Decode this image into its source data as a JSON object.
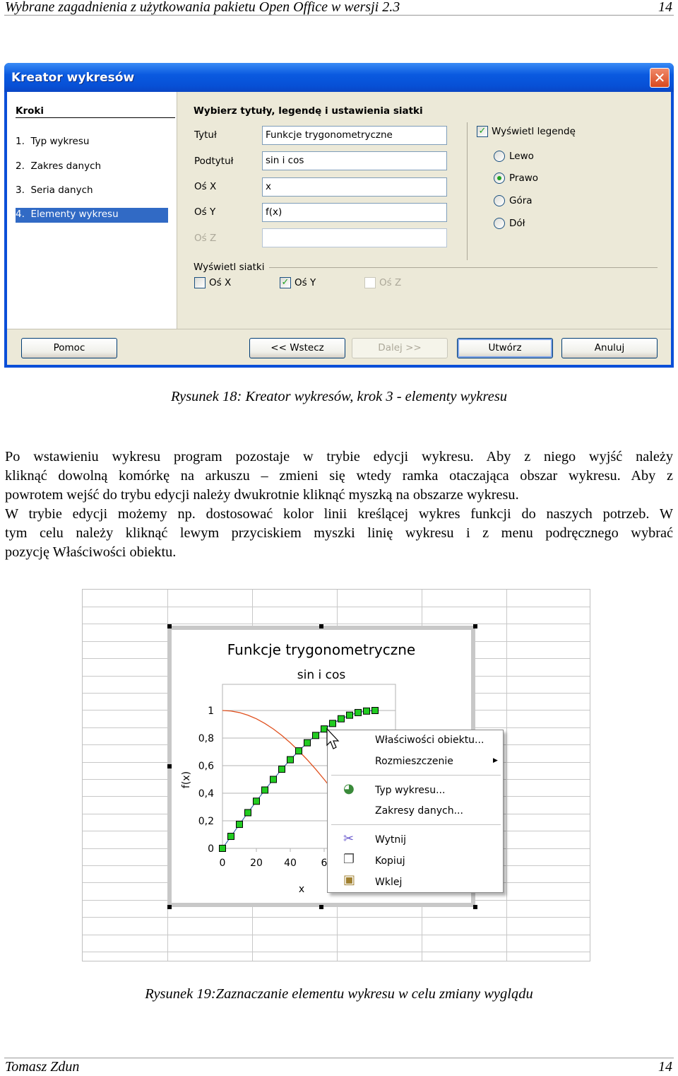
{
  "page_header": {
    "title": "Wybrane zagadnienia z użytkowania pakietu Open Office w wersji 2.3",
    "page": "14"
  },
  "dialog": {
    "title": "Kreator wykresów",
    "steps_heading": "Kroki",
    "steps": [
      "1.  Typ wykresu",
      "2.  Zakres danych",
      "3.  Seria danych",
      "4.  Elementy wykresu"
    ],
    "active_step": 4,
    "heading": "Wybierz tytuły, legendę i ustawienia siatki",
    "fields": [
      {
        "label": "Tytuł",
        "value": "Funkcje trygonometryczne",
        "enabled": true
      },
      {
        "label": "Podtytuł",
        "value": "sin i cos",
        "enabled": true
      },
      {
        "label": "Oś X",
        "value": "x",
        "enabled": true
      },
      {
        "label": "Oś Y",
        "value": "f(x)",
        "enabled": true
      },
      {
        "label": "Oś Z",
        "value": "",
        "enabled": false
      }
    ],
    "show_legend": {
      "label": "Wyświetl legendę",
      "checked": true
    },
    "legend_positions": [
      {
        "label": "Lewo",
        "selected": false
      },
      {
        "label": "Prawo",
        "selected": true
      },
      {
        "label": "Góra",
        "selected": false
      },
      {
        "label": "Dół",
        "selected": false
      }
    ],
    "grid_heading": "Wyświetl siatki",
    "grid": [
      {
        "label": "Oś X",
        "checked": false
      },
      {
        "label": "Oś Y",
        "checked": true
      },
      {
        "label": "Oś Z",
        "checked": false,
        "enabled": false
      }
    ],
    "buttons": {
      "help": "Pomoc",
      "back": "<< Wstecz",
      "next": "Dalej >>",
      "create": "Utwórz",
      "cancel": "Anuluj"
    },
    "check_color": "#21a121",
    "title_color": "#0a5ae0"
  },
  "caption1": "Rysunek 18: Kreator wykresów, krok 3 - elementy wykresu",
  "body_lines": [
    "Po wstawieniu wykresu program pozostaje w trybie edycji wykresu. Aby z niego wyjść należy",
    "kliknąć dowolną komórkę na arkuszu – zmieni się wtedy ramka otaczająca obszar wykresu. Aby z",
    "powrotem wejść do trybu edycji należy dwukrotnie kliknąć myszką na obszarze wykresu.",
    "W trybie edycji możemy np. dostosować kolor linii kreślącej wykres funkcji do naszych potrzeb. W",
    "tym celu należy kliknąć lewym przyciskiem myszki linię wykresu i z menu podręcznego wybrać",
    "pozycję Właściwości obiektu."
  ],
  "chart_data": {
    "type": "line",
    "title": "Funkcje trygonometryczne",
    "subtitle": "sin i cos",
    "xlabel": "x",
    "ylabel": "f(x)",
    "xlim": [
      0,
      100
    ],
    "ylim": [
      0,
      1.15
    ],
    "x_ticks": [
      "0",
      "20",
      "40",
      "6"
    ],
    "y_ticks": [
      "0",
      "0,2",
      "0,4",
      "0,6",
      "0,8",
      "1"
    ],
    "grid": "horizontal",
    "series": [
      {
        "x": [
          0,
          5,
          10,
          15,
          20,
          25,
          30,
          35,
          40,
          45,
          50,
          55,
          60,
          65,
          70,
          75,
          80,
          85,
          90
        ],
        "values": [
          0,
          0.087,
          0.174,
          0.259,
          0.342,
          0.423,
          0.5,
          0.574,
          0.643,
          0.707,
          0.766,
          0.819,
          0.866,
          0.906,
          0.94,
          0.966,
          0.985,
          0.996,
          1
        ],
        "color": "#22cc22",
        "marker": "square"
      },
      {
        "x": [
          0,
          5,
          10,
          15,
          20,
          25,
          30,
          35,
          40,
          45,
          50,
          55,
          60,
          65,
          70,
          75,
          80,
          85,
          90
        ],
        "values": [
          1,
          0.996,
          0.985,
          0.966,
          0.94,
          0.906,
          0.866,
          0.819,
          0.766,
          0.707,
          0.643,
          0.574,
          0.5,
          0.423,
          0.342,
          0.259,
          0.174,
          0.087,
          0
        ],
        "color": "#e0501e",
        "marker": "none"
      }
    ]
  },
  "context_menu": {
    "items": [
      {
        "label": "Właściwości obiektu...",
        "icon": ""
      },
      {
        "label": "Rozmieszczenie",
        "submenu": true
      },
      {
        "label": "Typ wykresu...",
        "icon": "chart-type-icon"
      },
      {
        "label": "Zakresy danych..."
      },
      {
        "label": "Wytnij",
        "icon": "scissors-icon"
      },
      {
        "label": "Kopiuj",
        "icon": "copy-icon"
      },
      {
        "label": "Wklej",
        "icon": "paste-icon"
      }
    ]
  },
  "caption2": "Rysunek 19:Zaznaczanie elementu wykresu w celu zmiany wyglądu",
  "page_footer": {
    "author": "Tomasz Zdun",
    "page": "14"
  }
}
